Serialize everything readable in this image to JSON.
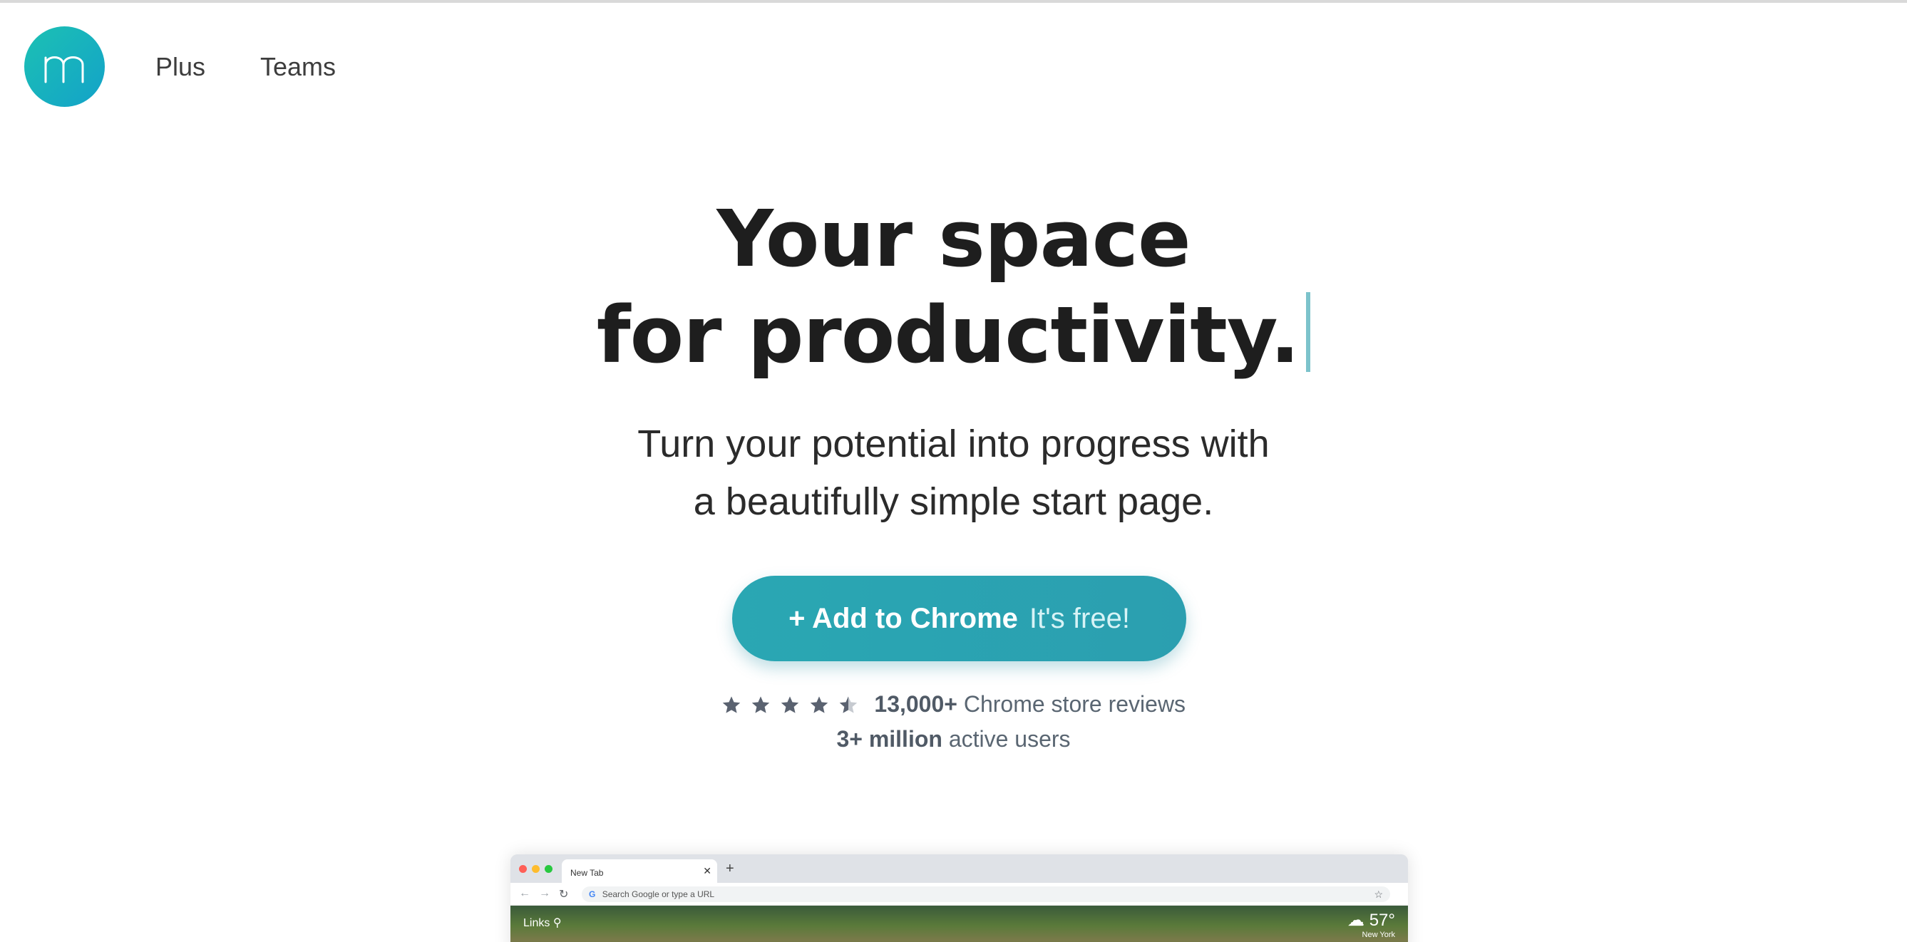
{
  "header": {
    "logo_letter": "m",
    "nav": [
      {
        "label": "Plus"
      },
      {
        "label": "Teams"
      }
    ]
  },
  "hero": {
    "headline_line1": "Your space",
    "headline_line2": "for productivity.",
    "sub_line1": "Turn your potential into progress with",
    "sub_line2": "a beautifully simple start page.",
    "cta_label": "+ Add to Chrome",
    "cta_free": "It's free!",
    "stars": {
      "rating": 4.5,
      "out_of": 5
    },
    "reviews_count": "13,000+",
    "reviews_text": "Chrome store reviews",
    "users_count": "3+ million",
    "users_text": "active users"
  },
  "browser_preview": {
    "tab_title": "New Tab",
    "omnibox_placeholder": "Search Google or type a URL",
    "links_label": "Links",
    "temperature": "57°",
    "city": "New York"
  },
  "colors": {
    "brand_teal": "#2aa7b3",
    "logo_gradient_start": "#1cc1b3",
    "logo_gradient_end": "#13a2c9",
    "caret": "#7cc3cb"
  }
}
